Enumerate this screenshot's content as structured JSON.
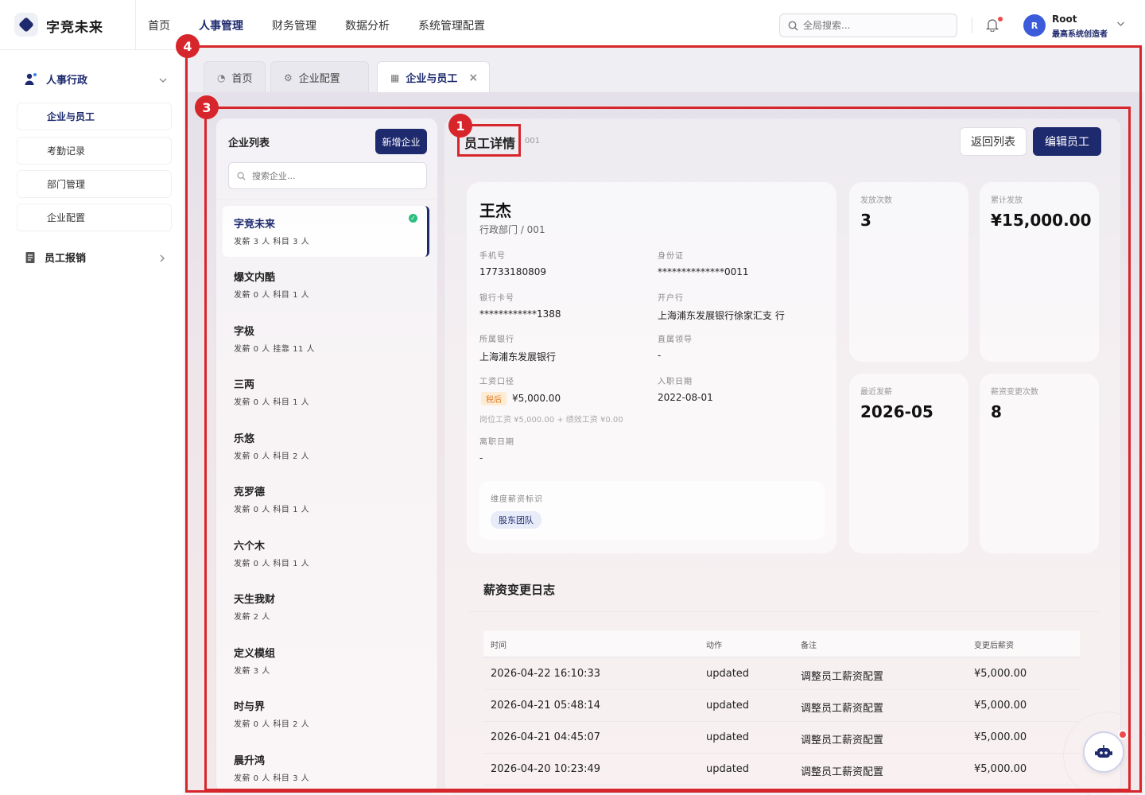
{
  "app": {
    "brand": "字竞未来"
  },
  "topnav": [
    "首页",
    "人事管理",
    "财务管理",
    "数据分析",
    "系统管理配置"
  ],
  "search": {
    "placeholder": "全局搜索..."
  },
  "user": {
    "avatar": "R",
    "name": "Root",
    "role": "最高系统创造者"
  },
  "sidebar": {
    "group1": "人事行政",
    "items": [
      "企业与员工",
      "考勤记录",
      "部门管理",
      "企业配置"
    ],
    "group2": "员工报销"
  },
  "tabs": [
    "首页",
    "企业配置",
    "企业与员工"
  ],
  "company_panel": {
    "title": "企业列表",
    "add_button": "新增企业",
    "search_placeholder": "搜索企业...",
    "companies": [
      {
        "name": "字竞未来",
        "meta": "发薪 3 人  科目 3 人"
      },
      {
        "name": "爆文内酷",
        "meta": "发薪 0 人  科目 1 人"
      },
      {
        "name": "字极",
        "meta": "发薪 0 人  挂靠 11 人"
      },
      {
        "name": "三两",
        "meta": "发薪 0 人  科目 1 人"
      },
      {
        "name": "乐悠",
        "meta": "发薪 0 人  科目 2 人"
      },
      {
        "name": "克罗德",
        "meta": "发薪 0 人  科目 1 人"
      },
      {
        "name": "六个木",
        "meta": "发薪 0 人  科目 1 人"
      },
      {
        "name": "天生我财",
        "meta": "发薪 2 人"
      },
      {
        "name": "定义模组",
        "meta": "发薪 3 人"
      },
      {
        "name": "时与界",
        "meta": "发薪 0 人  科目 2 人"
      },
      {
        "name": "晨升鸿",
        "meta": "发薪 0 人  科目 3 人"
      }
    ]
  },
  "detail": {
    "title": "员工详情",
    "subtitle": "001",
    "back_button": "返回列表",
    "edit_button": "编辑员工",
    "name": "王杰",
    "dept": "行政部门 / 001",
    "fields": {
      "phone_label": "手机号",
      "phone": "17733180809",
      "id_label": "身份证",
      "id": "**************0011",
      "bank_card_label": "银行卡号",
      "bank_card": "************1388",
      "branch_label": "开户行",
      "branch": "上海浦东发展银行徐家汇支 行",
      "bank_label": "所属银行",
      "bank": "上海浦东发展银行",
      "leader_label": "直属领导",
      "leader": "-",
      "salary_label": "工资口径",
      "tax_badge": "税后",
      "salary": "¥5,000.00",
      "salary_hint": "岗位工资 ¥5,000.00 + 绩效工资 ¥0.00",
      "join_label": "入职日期",
      "join": "2022-08-01",
      "leave_label": "离职日期",
      "leave": "-"
    },
    "tag_label": "维度薪资标识",
    "tag": "股东团队",
    "stats": {
      "count_label": "发放次数",
      "count": "3",
      "total_label": "累计发放",
      "total": "¥15,000.00",
      "recent_label": "最近发薪",
      "recent": "2026-05",
      "changes_label": "薪资变更次数",
      "changes": "8"
    }
  },
  "log": {
    "title": "薪资变更日志",
    "headers": [
      "时间",
      "动作",
      "备注",
      "变更后薪资"
    ],
    "rows": [
      [
        "2026-04-22 16:10:33",
        "updated",
        "调整员工薪资配置",
        "¥5,000.00"
      ],
      [
        "2026-04-21 05:48:14",
        "updated",
        "调整员工薪资配置",
        "¥5,000.00"
      ],
      [
        "2026-04-21 04:45:07",
        "updated",
        "调整员工薪资配置",
        "¥5,000.00"
      ],
      [
        "2026-04-20 10:23:49",
        "updated",
        "调整员工薪资配置",
        "¥5,000.00"
      ]
    ]
  },
  "annotations": [
    "1",
    "3",
    "4"
  ],
  "colors": {
    "accent": "#1e2a6e",
    "annotation": "#d7262b",
    "success": "#2dbd7e",
    "tax_badge": "#e0802a"
  }
}
